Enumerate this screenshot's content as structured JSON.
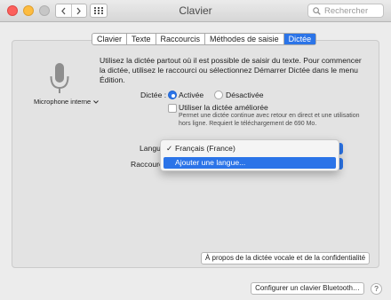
{
  "window": {
    "title": "Clavier",
    "search_placeholder": "Rechercher"
  },
  "tabs": [
    {
      "label": "Clavier"
    },
    {
      "label": "Texte"
    },
    {
      "label": "Raccourcis"
    },
    {
      "label": "Méthodes de saisie"
    },
    {
      "label": "Dictée",
      "active": true
    }
  ],
  "microphone": {
    "label": "Microphone interne"
  },
  "dictation": {
    "description": "Utilisez la dictée partout où il est possible de saisir du texte. Pour commencer la dictée, utilisez le raccourci ou sélectionnez Démarrer Dictée dans le menu Édition.",
    "label": "Dictée :",
    "on_label": "Activée",
    "off_label": "Désactivée",
    "selected": "Activée",
    "enhanced_label": "Utiliser la dictée améliorée",
    "enhanced_checked": false,
    "enhanced_note": "Permet une dictée continue avec retour en direct et une utilisation hors ligne. Requiert le téléchargement de 690 Mo.",
    "language_label": "Langue",
    "shortcut_label": "Raccourci"
  },
  "language_menu": {
    "checkmark": "✓",
    "items": [
      "Français (France)",
      "Ajouter une langue..."
    ],
    "checked_item": "Français (France)",
    "highlighted_item": "Ajouter une langue..."
  },
  "buttons": {
    "about": "À propos de la dictée vocale et de la confidentialité",
    "bluetooth": "Configurer un clavier Bluetooth…",
    "help": "?"
  },
  "colors": {
    "accent": "#2b74e8",
    "close": "#fc605c",
    "minimize": "#fdbc40",
    "zoom": "#c6c6c6"
  }
}
